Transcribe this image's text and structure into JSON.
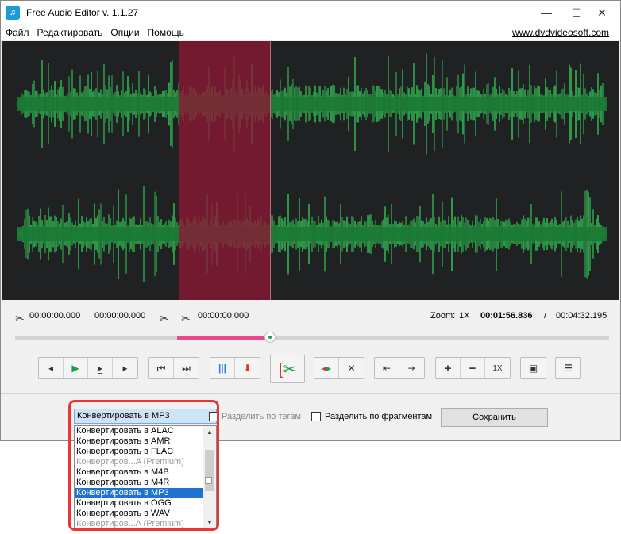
{
  "window": {
    "title": "Free Audio Editor v. 1.1.27",
    "minimize": "—",
    "maximize": "☐",
    "close": "✕"
  },
  "menu": {
    "items": [
      "Файл",
      "Редактировать",
      "Опции",
      "Помощь"
    ],
    "site_link": "www.dvdvideosoft.com"
  },
  "waveform": {
    "wave_color": "#2e9c4a",
    "selection_color": "#8c1834",
    "background": "#1f2123"
  },
  "timeline": {
    "selection_start": "00:00:00.000",
    "selection_end": "00:00:00.000",
    "cut_time": "00:00:00.000",
    "zoom_label": "Zoom:",
    "zoom_value": "1X",
    "current_time": "00:01:56.836",
    "separator": "/",
    "total_time": "00:04:32.195"
  },
  "toolbar": {
    "zoom_level": "1X"
  },
  "bottom": {
    "format_selected": "Конвертировать в MP3",
    "split_by_tags": "Разделить по тегам",
    "split_by_fragments": "Разделить по фрагментам",
    "save_label": "Сохранить"
  },
  "dropdown": {
    "items": [
      {
        "label": "Конвертировать в ALAC",
        "state": "normal"
      },
      {
        "label": "Конвертировать в AMR",
        "state": "normal"
      },
      {
        "label": "Конвертировать в FLAC",
        "state": "normal"
      },
      {
        "label": "Конвертиров...A (Premium)",
        "state": "disabled"
      },
      {
        "label": "Конвертировать в M4B",
        "state": "normal"
      },
      {
        "label": "Конвертировать в M4R",
        "state": "normal"
      },
      {
        "label": "Конвертировать в MP3",
        "state": "selected"
      },
      {
        "label": "Конвертировать в OGG",
        "state": "normal"
      },
      {
        "label": "Конвертировать в WAV",
        "state": "normal"
      },
      {
        "label": "Конвертиров...A (Premium)",
        "state": "disabled"
      }
    ]
  }
}
